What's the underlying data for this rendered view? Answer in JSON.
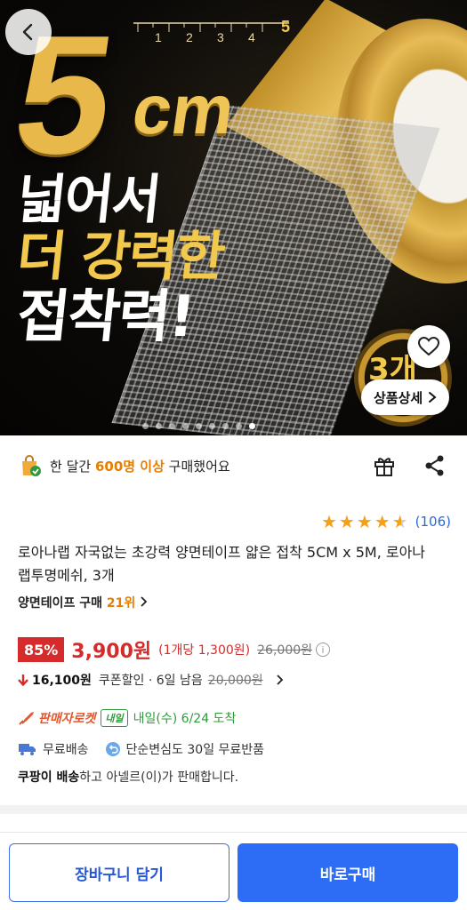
{
  "hero": {
    "ruler_ticks": [
      "1",
      "2",
      "3",
      "4"
    ],
    "ruler_end": "5",
    "big_number": "5",
    "big_unit": "cm",
    "headline_1": "넓어서",
    "headline_2": "더 강력한",
    "headline_3": "접착력!",
    "badge": "3개",
    "detail_button": "상품상세",
    "slide_count": 9,
    "active_slide": 9
  },
  "purchase": {
    "prefix": "한 달간",
    "count": "600명 이상",
    "suffix": "구매했어요"
  },
  "rating": {
    "stars": 4.5,
    "review_count": "(106)"
  },
  "product": {
    "title": "로아나랩 자국없는 초강력 양면테이프 얇은 접착 5CM x 5M, 로아나랩투명메쉬, 3개",
    "rank_label": "양면테이프 구매",
    "rank_value": "21위"
  },
  "price": {
    "discount": "85%",
    "sale": "3,900원",
    "unit": "(1개당 1,300원)",
    "original": "26,000원",
    "coupon_amount": "16,100원",
    "coupon_label": "쿠폰할인 · 6일 남음",
    "coupon_original": "20,000원"
  },
  "delivery": {
    "rocket": "판매자로켓",
    "tomorrow_tag": "내일",
    "arrival": "내일(수) 6/24 도착",
    "free_shipping": "무료배송",
    "return_policy": "단순변심도 30일 무료반품",
    "seller_bold": "쿠팡이 배송",
    "seller_rest": "하고 아넬르(이)가 판매합니다."
  },
  "buttons": {
    "cart": "장바구니 담기",
    "buy": "바로구매"
  },
  "colors": {
    "accent_blue": "#2d6df5",
    "price_red": "#d62b2b",
    "highlight_orange": "#e67e00",
    "rocket_green": "#2c9c3a",
    "star": "#f4a01a"
  }
}
